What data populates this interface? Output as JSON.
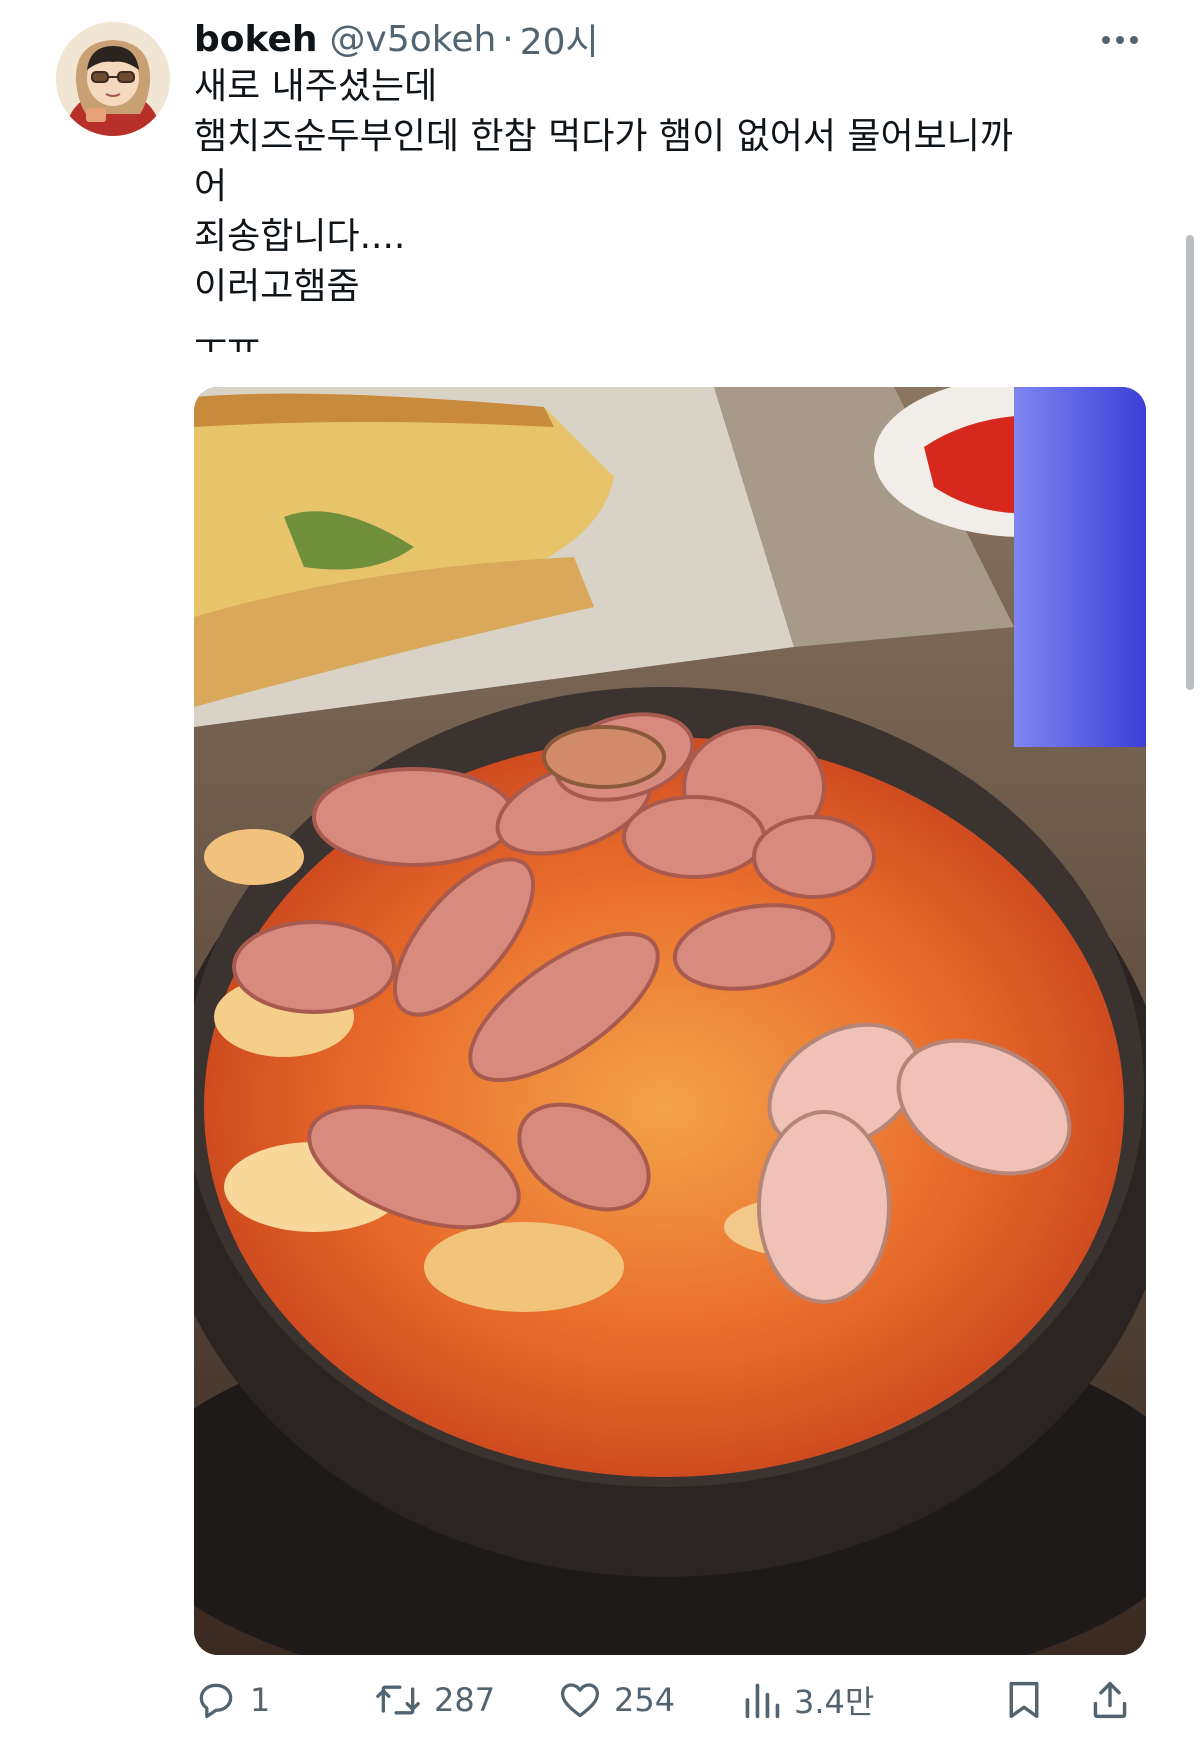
{
  "author": {
    "display_name": "bokeh",
    "handle": "@v5okeh",
    "separator": "·",
    "time": "20시"
  },
  "tweet": {
    "lines": [
      "새로 내주셨는데",
      "햄치즈순두부인데 한참 먹다가 햄이 없어서 물어보니까",
      "어",
      "죄송합니다....",
      "이러고햄줌",
      "ㅜㅠ"
    ]
  },
  "actions": {
    "reply_count": "1",
    "retweet_count": "287",
    "like_count": "254",
    "view_count": "3.4만"
  },
  "icons": {
    "more": "more-horizontal-icon",
    "reply": "reply-icon",
    "retweet": "retweet-icon",
    "like": "heart-icon",
    "views": "analytics-icon",
    "bookmark": "bookmark-icon",
    "share": "share-icon"
  },
  "colors": {
    "text": "#0f1419",
    "secondary": "#536471"
  }
}
